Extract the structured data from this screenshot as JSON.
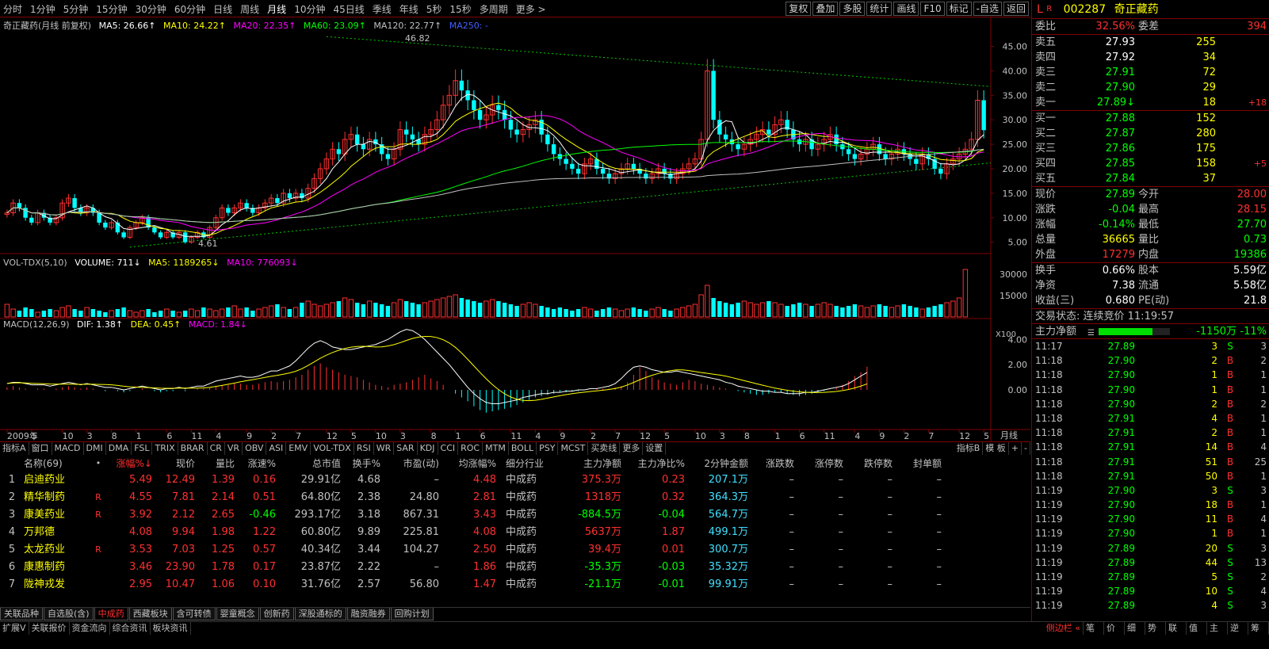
{
  "toolbar": {
    "periods": [
      "分时",
      "1分钟",
      "5分钟",
      "15分钟",
      "30分钟",
      "60分钟",
      "日线",
      "周线",
      "月线",
      "10分钟",
      "45日线",
      "季线",
      "年线",
      "5秒",
      "15秒",
      "多周期",
      "更多 >"
    ],
    "active_period": "月线",
    "tools": [
      "复权",
      "叠加",
      "多股",
      "统计",
      "画线",
      "F10",
      "标记",
      "-自选",
      "返回"
    ]
  },
  "chart_legend": {
    "name": "奇正藏药(月线 前复权)",
    "ma5": "MA5: 26.66↑",
    "ma10": "MA10: 24.22↑",
    "ma20": "MA20: 22.35↑",
    "ma60": "MA60: 23.09↑",
    "ma120": "MA120: 22.77↑",
    "ma250": "MA250: -",
    "high_label": "46.82",
    "low_label": "4.61",
    "vol_name": "VOL-TDX(5,10)",
    "vol_volume": "VOLUME: 711↓",
    "vol_ma5": "MA5: 1189265↓",
    "vol_ma10": "MA10: 776093↓",
    "vol_unit": "X100",
    "macd_name": "MACD(12,26,9)",
    "macd_dif": "DIF: 1.38↑",
    "macd_dea": "DEA: 0.45↑",
    "macd_macd": "MACD: 1.84↓",
    "period_label": "月线"
  },
  "colors": {
    "up": "#ff3030",
    "down": "#00ffff",
    "accent_red": "#800000",
    "yellow": "#ffff00",
    "green": "#00ff00"
  },
  "chart_data": {
    "type": "candlestick",
    "price_axis": [
      5.0,
      10.0,
      15.0,
      20.0,
      25.0,
      30.0,
      35.0,
      40.0,
      45.0
    ],
    "ylim": [
      3,
      48
    ],
    "vol_axis": [
      15000,
      30000
    ],
    "macd_axis": [
      0.0,
      2.0,
      4.0
    ],
    "x_ticks": [
      "2009年",
      "5",
      "10",
      "3",
      "8",
      "1",
      "6",
      "11",
      "4",
      "9",
      "2",
      "7",
      "12",
      "5",
      "10",
      "3",
      "8",
      "1",
      "6",
      "11",
      "4",
      "9",
      "2",
      "7",
      "12",
      "5",
      "10",
      "3",
      "8",
      "1",
      "6",
      "11",
      "4",
      "9",
      "2",
      "7",
      "12",
      "5"
    ],
    "closes": [
      11,
      13,
      12,
      10,
      9,
      11,
      10,
      9,
      10,
      13,
      14,
      12,
      11,
      12,
      11,
      9,
      8,
      9,
      7,
      6,
      8,
      9,
      10,
      8,
      7,
      6,
      7,
      6,
      7,
      5,
      6,
      7,
      6,
      8,
      10,
      12,
      11,
      12,
      13,
      12,
      11,
      12,
      13,
      14,
      13,
      15,
      14,
      15,
      14,
      16,
      18,
      20,
      22,
      24,
      23,
      26,
      27,
      25,
      24,
      26,
      25,
      23,
      22,
      24,
      28,
      27,
      26,
      25,
      27,
      28,
      30,
      33,
      35,
      38,
      36,
      34,
      32,
      30,
      31,
      33,
      32,
      30,
      28,
      27,
      28,
      29,
      30,
      27,
      25,
      23,
      22,
      21,
      20,
      19,
      21,
      22,
      20,
      19,
      18,
      19,
      20,
      21,
      20,
      19,
      18,
      19,
      20,
      19,
      18,
      19,
      20,
      21,
      22,
      26,
      40,
      30,
      27,
      26,
      25,
      24,
      25,
      26,
      27,
      28,
      27,
      29,
      30,
      28,
      26,
      25,
      26,
      24,
      25,
      26,
      27,
      25,
      24,
      23,
      22,
      23,
      24,
      25,
      23,
      22,
      23,
      24,
      23,
      22,
      21,
      23,
      22,
      20,
      19,
      21,
      22,
      23,
      24,
      26,
      34,
      27.89
    ],
    "volumes": [
      8,
      5,
      4,
      6,
      5,
      3,
      4,
      5,
      4,
      6,
      7,
      5,
      4,
      6,
      5,
      4,
      3,
      4,
      5,
      6,
      4,
      3,
      4,
      5,
      3,
      4,
      5,
      4,
      3,
      4,
      5,
      4,
      6,
      5,
      4,
      5,
      6,
      7,
      5,
      6,
      4,
      5,
      6,
      7,
      8,
      6,
      5,
      6,
      9,
      10,
      8,
      7,
      8,
      9,
      10,
      12,
      11,
      9,
      8,
      10,
      9,
      8,
      7,
      9,
      11,
      10,
      9,
      8,
      9,
      10,
      11,
      12,
      13,
      14,
      12,
      11,
      10,
      9,
      10,
      11,
      10,
      9,
      8,
      7,
      8,
      9,
      8,
      7,
      6,
      5,
      6,
      5,
      4,
      5,
      6,
      5,
      4,
      5,
      6,
      5,
      4,
      5,
      6,
      5,
      4,
      5,
      6,
      5,
      4,
      5,
      6,
      7,
      8,
      14,
      20,
      12,
      10,
      9,
      8,
      9,
      10,
      9,
      8,
      9,
      10,
      9,
      8,
      7,
      8,
      9,
      8,
      7,
      8,
      9,
      8,
      7,
      6,
      7,
      8,
      7,
      6,
      7,
      8,
      7,
      6,
      7,
      8,
      7,
      6,
      5,
      6,
      7,
      8,
      9,
      10,
      12,
      30
    ],
    "macd_bars": [
      0.2,
      0.3,
      0.2,
      0.1,
      0.0,
      0.1,
      0.1,
      0.0,
      0.1,
      0.2,
      0.3,
      0.2,
      0.1,
      0.2,
      0.1,
      0.0,
      -0.1,
      0.0,
      -0.1,
      -0.2,
      -0.1,
      0.0,
      0.1,
      0.0,
      -0.1,
      -0.2,
      -0.1,
      -0.1,
      0.0,
      -0.1,
      0.0,
      0.1,
      0.1,
      0.2,
      0.3,
      0.4,
      0.4,
      0.5,
      0.5,
      0.4,
      0.4,
      0.5,
      0.6,
      0.7,
      0.6,
      0.7,
      0.8,
      1.0,
      1.2,
      1.6,
      1.9,
      2.1,
      1.8,
      1.6,
      1.4,
      1.2,
      1.1,
      1.0,
      0.8,
      0.6,
      0.4,
      0.3,
      0.2,
      0.4,
      0.5,
      0.6,
      0.8,
      1.0,
      1.2,
      0.9,
      0.7,
      0.4,
      0.0,
      -0.3,
      -0.6,
      -0.9,
      -1.3,
      -1.6,
      -1.8,
      -1.7,
      -1.6,
      -1.5,
      -1.4,
      -1.2,
      -1.0,
      -0.8,
      -0.6,
      -0.5,
      -0.4,
      -0.3,
      -0.2,
      -0.2,
      -0.1,
      -0.1,
      0.0,
      0.0,
      0.1,
      0.1,
      0.1,
      0.2,
      0.3,
      0.6,
      1.2,
      1.8,
      1.5,
      1.0,
      0.8,
      0.6,
      0.5,
      0.4,
      0.6,
      0.8,
      0.7,
      0.5,
      0.4,
      0.3,
      0.2,
      0.1,
      0.0,
      -0.1,
      -0.2,
      -0.3,
      -0.4,
      -0.4,
      -0.3,
      -0.2,
      -0.2,
      -0.3,
      -0.4,
      -0.5,
      -0.4,
      -0.3,
      -0.2,
      -0.1,
      0.0,
      0.2,
      0.4,
      0.7,
      1.1,
      1.4,
      1.84
    ],
    "dif": [
      0.5,
      0.6,
      0.6,
      0.5,
      0.4,
      0.4,
      0.4,
      0.3,
      0.4,
      0.5,
      0.6,
      0.5,
      0.4,
      0.5,
      0.4,
      0.3,
      0.2,
      0.2,
      0.1,
      0.0,
      0.1,
      0.2,
      0.3,
      0.2,
      0.1,
      0.0,
      0.1,
      0.1,
      0.2,
      0.1,
      0.2,
      0.3,
      0.3,
      0.5,
      0.7,
      0.8,
      0.9,
      1.0,
      1.1,
      1.0,
      1.0,
      1.1,
      1.3,
      1.5,
      1.5,
      1.7,
      1.9,
      2.3,
      2.8,
      3.3,
      3.7,
      3.9,
      3.7,
      3.4,
      3.3,
      3.2,
      3.2,
      3.3,
      3.4,
      3.5,
      3.6,
      3.8,
      4.0,
      4.3,
      4.6,
      4.8,
      4.7,
      4.4,
      4.0,
      3.5,
      3.0,
      2.5,
      2.0,
      1.4,
      0.8,
      0.2,
      -0.3,
      -0.7,
      -1.0,
      -1.1,
      -1.1,
      -1.0,
      -0.9,
      -0.8,
      -0.6,
      -0.5,
      -0.4,
      -0.3,
      -0.3,
      -0.2,
      -0.2,
      -0.1,
      -0.1,
      0.0,
      0.0,
      0.1,
      0.1,
      0.2,
      0.3,
      0.5,
      0.9,
      1.4,
      1.8,
      1.9,
      1.8,
      1.6,
      1.5,
      1.4,
      1.4,
      1.5,
      1.4,
      1.3,
      1.2,
      1.1,
      1.0,
      0.9,
      0.8,
      0.6,
      0.5,
      0.3,
      0.2,
      0.1,
      0.0,
      -0.1,
      -0.1,
      -0.2,
      -0.2,
      -0.3,
      -0.3,
      -0.3,
      -0.2,
      -0.2,
      -0.1,
      0.0,
      0.1,
      0.2,
      0.3,
      0.5,
      0.8,
      1.1,
      1.38
    ],
    "series": [
      {
        "name": "MA5",
        "color": "#ffffff"
      },
      {
        "name": "MA10",
        "color": "#ffff00"
      },
      {
        "name": "MA20",
        "color": "#ff00ff"
      },
      {
        "name": "MA60",
        "color": "#00ff00"
      },
      {
        "name": "MA120",
        "color": "#c0c0c0"
      }
    ]
  },
  "ind_tabs": [
    "指标A",
    "窗口",
    "MACD",
    "DMI",
    "DMA",
    "FSL",
    "TRIX",
    "BRAR",
    "CR",
    "VR",
    "OBV",
    "ASI",
    "EMV",
    "VOL-TDX",
    "RSI",
    "WR",
    "SAR",
    "KDJ",
    "CCI",
    "ROC",
    "MTM",
    "BOLL",
    "PSY",
    "MCST",
    "买卖线",
    "更多",
    "设置"
  ],
  "ind_tabs_right": [
    "指标B",
    "模 板",
    "+",
    "-"
  ],
  "list": {
    "headers": [
      "",
      "名称(69)",
      "•",
      "涨幅%↓",
      "现价",
      "量比",
      "涨速%",
      "总市值",
      "换手%",
      "市盈(动)",
      "均涨幅%",
      "细分行业",
      "主力净额",
      "主力净比%",
      "2分钟金额",
      "涨跌数",
      "涨停数",
      "跌停数",
      "封单额"
    ],
    "rows": [
      {
        "idx": "1",
        "name": "启迪药业",
        "r": "",
        "chg": "5.49",
        "price": "12.49",
        "vr": "1.39",
        "spd": "0.16",
        "cap": "29.91亿",
        "turn": "4.68",
        "pe": "–",
        "avg": "4.48",
        "ind": "中成药",
        "net": "375.3万",
        "netp": "0.23",
        "m2": "207.1万",
        "a": "–",
        "b": "–",
        "c": "–",
        "d": "–",
        "spd_dir": "up",
        "net_dir": "up"
      },
      {
        "idx": "2",
        "name": "精华制药",
        "r": "R",
        "chg": "4.55",
        "price": "7.81",
        "vr": "2.14",
        "spd": "0.51",
        "cap": "64.80亿",
        "turn": "2.38",
        "pe": "24.80",
        "avg": "2.81",
        "ind": "中成药",
        "net": "1318万",
        "netp": "0.32",
        "m2": "364.3万",
        "a": "–",
        "b": "–",
        "c": "–",
        "d": "–",
        "spd_dir": "up",
        "net_dir": "up"
      },
      {
        "idx": "3",
        "name": "康美药业",
        "r": "R",
        "chg": "3.92",
        "price": "2.12",
        "vr": "2.65",
        "spd": "-0.46",
        "cap": "293.17亿",
        "turn": "3.18",
        "pe": "867.31",
        "avg": "3.43",
        "ind": "中成药",
        "net": "-884.5万",
        "netp": "-0.04",
        "m2": "564.7万",
        "a": "–",
        "b": "–",
        "c": "–",
        "d": "–",
        "spd_dir": "dn",
        "net_dir": "dn"
      },
      {
        "idx": "4",
        "name": "万邦德",
        "r": "",
        "chg": "4.08",
        "price": "9.94",
        "vr": "1.98",
        "spd": "1.22",
        "cap": "60.80亿",
        "turn": "9.89",
        "pe": "225.81",
        "avg": "4.08",
        "ind": "中成药",
        "net": "5637万",
        "netp": "1.87",
        "m2": "499.1万",
        "a": "–",
        "b": "–",
        "c": "–",
        "d": "–",
        "spd_dir": "up",
        "net_dir": "up"
      },
      {
        "idx": "5",
        "name": "太龙药业",
        "r": "R",
        "chg": "3.53",
        "price": "7.03",
        "vr": "1.25",
        "spd": "0.57",
        "cap": "40.34亿",
        "turn": "3.44",
        "pe": "104.27",
        "avg": "2.50",
        "ind": "中成药",
        "net": "39.4万",
        "netp": "0.01",
        "m2": "300.7万",
        "a": "–",
        "b": "–",
        "c": "–",
        "d": "–",
        "spd_dir": "up",
        "net_dir": "up"
      },
      {
        "idx": "6",
        "name": "康惠制药",
        "r": "",
        "chg": "3.46",
        "price": "23.90",
        "vr": "1.78",
        "spd": "0.17",
        "cap": "23.87亿",
        "turn": "2.22",
        "pe": "–",
        "avg": "1.86",
        "ind": "中成药",
        "net": "-35.3万",
        "netp": "-0.03",
        "m2": "35.32万",
        "a": "–",
        "b": "–",
        "c": "–",
        "d": "–",
        "spd_dir": "up",
        "net_dir": "dn"
      },
      {
        "idx": "7",
        "name": "陇神戎发",
        "r": "",
        "chg": "2.95",
        "price": "10.47",
        "vr": "1.06",
        "spd": "0.10",
        "cap": "31.76亿",
        "turn": "2.57",
        "pe": "56.80",
        "avg": "1.47",
        "ind": "中成药",
        "net": "-21.1万",
        "netp": "-0.01",
        "m2": "99.91万",
        "a": "–",
        "b": "–",
        "c": "–",
        "d": "–",
        "spd_dir": "up",
        "net_dir": "dn"
      }
    ]
  },
  "bottom_tabs": [
    "关联品种",
    "自选股(含)",
    "中成药",
    "西藏板块",
    "含可转债",
    "婴童概念",
    "创新药",
    "深股通标的",
    "融资融券",
    "回购计划"
  ],
  "bottom_active": "中成药",
  "status": [
    "扩展V",
    "关联报价",
    "资金流向",
    "综合资讯",
    "板块资讯"
  ],
  "status_right": [
    "侧边栏 «",
    "笔",
    "价",
    "细",
    "势",
    "联",
    "值",
    "主",
    "逆",
    "筹"
  ],
  "quote": {
    "mark": "L",
    "r": "R",
    "code": "002287",
    "name": "奇正藏药",
    "weibi_label": "委比",
    "weibi": "32.56%",
    "weicha_label": "委差",
    "weicha": "394",
    "asks": [
      {
        "label": "卖五",
        "price": "27.93",
        "vol": "255",
        "chg": ""
      },
      {
        "label": "卖四",
        "price": "27.92",
        "vol": "34",
        "chg": ""
      },
      {
        "label": "卖三",
        "price": "27.91",
        "vol": "72",
        "chg": ""
      },
      {
        "label": "卖二",
        "price": "27.90",
        "vol": "29",
        "chg": ""
      },
      {
        "label": "卖一",
        "price": "27.89↓",
        "vol": "18",
        "chg": "+18"
      }
    ],
    "bids": [
      {
        "label": "买一",
        "price": "27.88",
        "vol": "152",
        "chg": ""
      },
      {
        "label": "买二",
        "price": "27.87",
        "vol": "280",
        "chg": ""
      },
      {
        "label": "买三",
        "price": "27.86",
        "vol": "175",
        "chg": ""
      },
      {
        "label": "买四",
        "price": "27.85",
        "vol": "158",
        "chg": "+5"
      },
      {
        "label": "买五",
        "price": "27.84",
        "vol": "37",
        "chg": ""
      }
    ],
    "stats": [
      {
        "l1": "现价",
        "v1": "27.89",
        "l2": "今开",
        "v2": "28.00",
        "c1": "dn",
        "c2": "up"
      },
      {
        "l1": "涨跌",
        "v1": "-0.04",
        "l2": "最高",
        "v2": "28.15",
        "c1": "dn",
        "c2": "up"
      },
      {
        "l1": "涨幅",
        "v1": "-0.14%",
        "l2": "最低",
        "v2": "27.70",
        "c1": "dn",
        "c2": "dn"
      },
      {
        "l1": "总量",
        "v1": "36665",
        "l2": "量比",
        "v2": "0.73",
        "c1": "yl",
        "c2": "dn"
      },
      {
        "l1": "外盘",
        "v1": "17279",
        "l2": "内盘",
        "v2": "19386",
        "c1": "up",
        "c2": "dn"
      }
    ],
    "stats2": [
      {
        "l1": "换手",
        "v1": "0.66%",
        "l2": "股本",
        "v2": "5.59亿"
      },
      {
        "l1": "净资",
        "v1": "7.38",
        "l2": "流通",
        "v2": "5.58亿"
      },
      {
        "l1": "收益(三)",
        "v1": "0.680",
        "l2": "PE(动)",
        "v2": "21.8"
      }
    ],
    "trade_state": "交易状态: 连续竞价 11:19:57",
    "main_net_label": "主力净额",
    "main_net_value": "-1150万",
    "main_net_pct": "-11%",
    "main_net_fill": 0.75
  },
  "ticks": [
    {
      "t": "11:17",
      "p": "27.89",
      "v": "3",
      "bs": "S",
      "n": "3"
    },
    {
      "t": "11:18",
      "p": "27.90",
      "v": "2",
      "bs": "B",
      "n": "2"
    },
    {
      "t": "11:18",
      "p": "27.90",
      "v": "1",
      "bs": "B",
      "n": "1"
    },
    {
      "t": "11:18",
      "p": "27.90",
      "v": "1",
      "bs": "B",
      "n": "1"
    },
    {
      "t": "11:18",
      "p": "27.90",
      "v": "2",
      "bs": "B",
      "n": "2"
    },
    {
      "t": "11:18",
      "p": "27.91",
      "v": "4",
      "bs": "B",
      "n": "1"
    },
    {
      "t": "11:18",
      "p": "27.91",
      "v": "2",
      "bs": "B",
      "n": "1"
    },
    {
      "t": "11:18",
      "p": "27.91",
      "v": "14",
      "bs": "B",
      "n": "4"
    },
    {
      "t": "11:18",
      "p": "27.91",
      "v": "51",
      "bs": "B",
      "n": "25"
    },
    {
      "t": "11:18",
      "p": "27.91",
      "v": "50",
      "bs": "B",
      "n": "1"
    },
    {
      "t": "11:19",
      "p": "27.90",
      "v": "3",
      "bs": "S",
      "n": "3"
    },
    {
      "t": "11:19",
      "p": "27.90",
      "v": "18",
      "bs": "B",
      "n": "1"
    },
    {
      "t": "11:19",
      "p": "27.90",
      "v": "11",
      "bs": "B",
      "n": "4"
    },
    {
      "t": "11:19",
      "p": "27.90",
      "v": "1",
      "bs": "B",
      "n": "1"
    },
    {
      "t": "11:19",
      "p": "27.89",
      "v": "20",
      "bs": "S",
      "n": "3"
    },
    {
      "t": "11:19",
      "p": "27.89",
      "v": "44",
      "bs": "S",
      "n": "13"
    },
    {
      "t": "11:19",
      "p": "27.89",
      "v": "5",
      "bs": "S",
      "n": "2"
    },
    {
      "t": "11:19",
      "p": "27.89",
      "v": "10",
      "bs": "S",
      "n": "4"
    },
    {
      "t": "11:19",
      "p": "27.89",
      "v": "4",
      "bs": "S",
      "n": "3"
    }
  ]
}
